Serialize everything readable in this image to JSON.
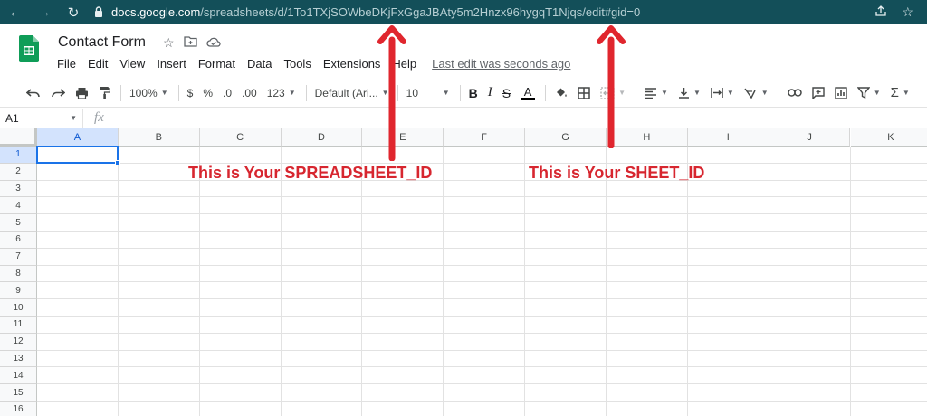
{
  "browser": {
    "url_host": "docs.google.com",
    "url_path": "/spreadsheets/d/1To1TXjSOWbeDKjFxGgaJBAty5m2Hnzx96hygqT1Njqs/edit#gid=0",
    "icons": [
      "back-arrow-icon",
      "forward-arrow-icon",
      "reload-icon",
      "lock-icon",
      "share-icon",
      "star-icon"
    ]
  },
  "doc": {
    "title": "Contact Form",
    "menu": [
      "File",
      "Edit",
      "View",
      "Insert",
      "Format",
      "Data",
      "Tools",
      "Extensions",
      "Help"
    ],
    "last_edit": "Last edit was seconds ago"
  },
  "toolbar": {
    "zoom": "100%",
    "currency": "$",
    "percent": "%",
    "decrease_decimal": ".0",
    "increase_decimal": ".00",
    "more_formats": "123",
    "font": "Default (Ari...",
    "font_size": "10",
    "bold": "B",
    "italic": "I",
    "strike": "S",
    "text_color": "A"
  },
  "formula_bar": {
    "cell_ref": "A1",
    "fx": "fx"
  },
  "grid": {
    "columns": [
      "A",
      "B",
      "C",
      "D",
      "E",
      "F",
      "G",
      "H",
      "I",
      "J",
      "K"
    ],
    "rows": [
      "1",
      "2",
      "3",
      "4",
      "5",
      "6",
      "7",
      "8",
      "9",
      "10",
      "11",
      "12",
      "13",
      "14",
      "15",
      "16"
    ],
    "selected": "A1"
  },
  "annotations": {
    "spreadsheet_id": "This is Your SPREADSHEET_ID",
    "sheet_id": "This is Your SHEET_ID"
  },
  "colors": {
    "browser_bar": "#134f59",
    "annotation_red": "#d7262f",
    "selection_blue": "#1a73e8",
    "sheets_green": "#0f9d58"
  }
}
